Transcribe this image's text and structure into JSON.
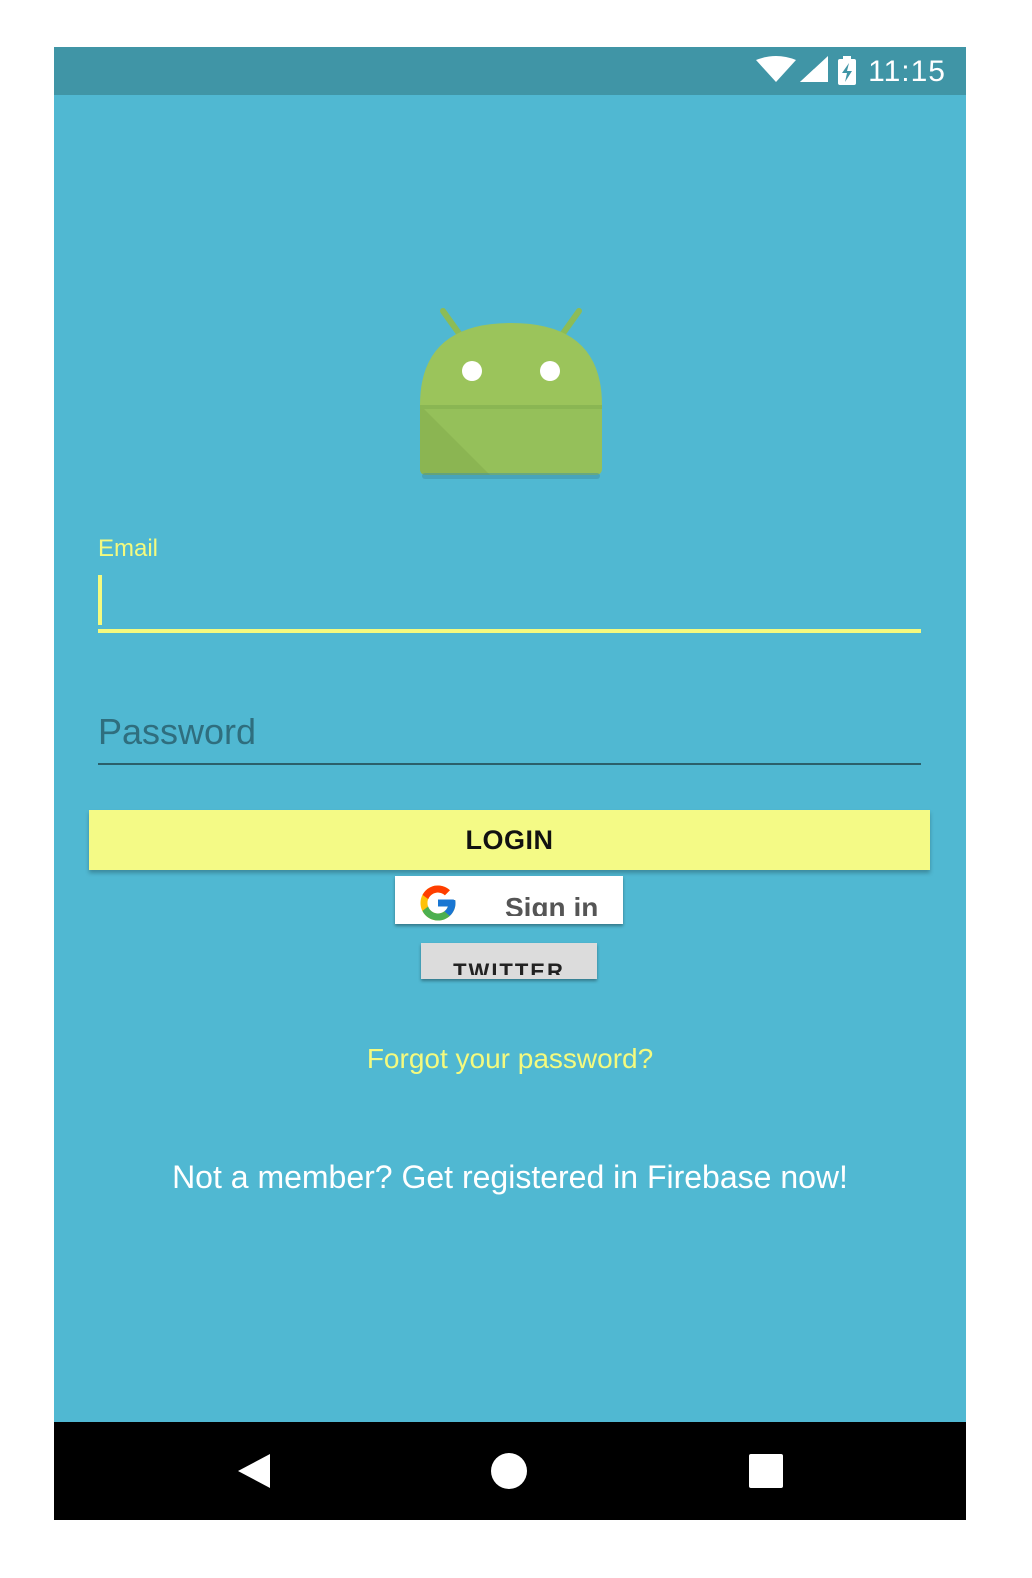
{
  "status_bar": {
    "time": "11:15",
    "icons": [
      "wifi-icon",
      "cell-signal-icon",
      "battery-charging-icon"
    ]
  },
  "app_logo": "android-robot-logo",
  "email": {
    "label": "Email",
    "value": ""
  },
  "password": {
    "placeholder": "Password",
    "value": ""
  },
  "login_button": "LOGIN",
  "google_button": {
    "icon": "google-g-icon",
    "label": "Sign in"
  },
  "twitter_button": "TWITTER",
  "forgot_link": "Forgot your password?",
  "register_link": "Not a member? Get registered in Firebase now!",
  "nav_bar": {
    "icons": [
      "back-icon",
      "home-icon",
      "recents-icon"
    ]
  },
  "colors": {
    "background": "#50b8d2",
    "status_bar": "#4095a6",
    "accent_yellow": "#f4fa7e",
    "login_button": "#f4fa86"
  }
}
